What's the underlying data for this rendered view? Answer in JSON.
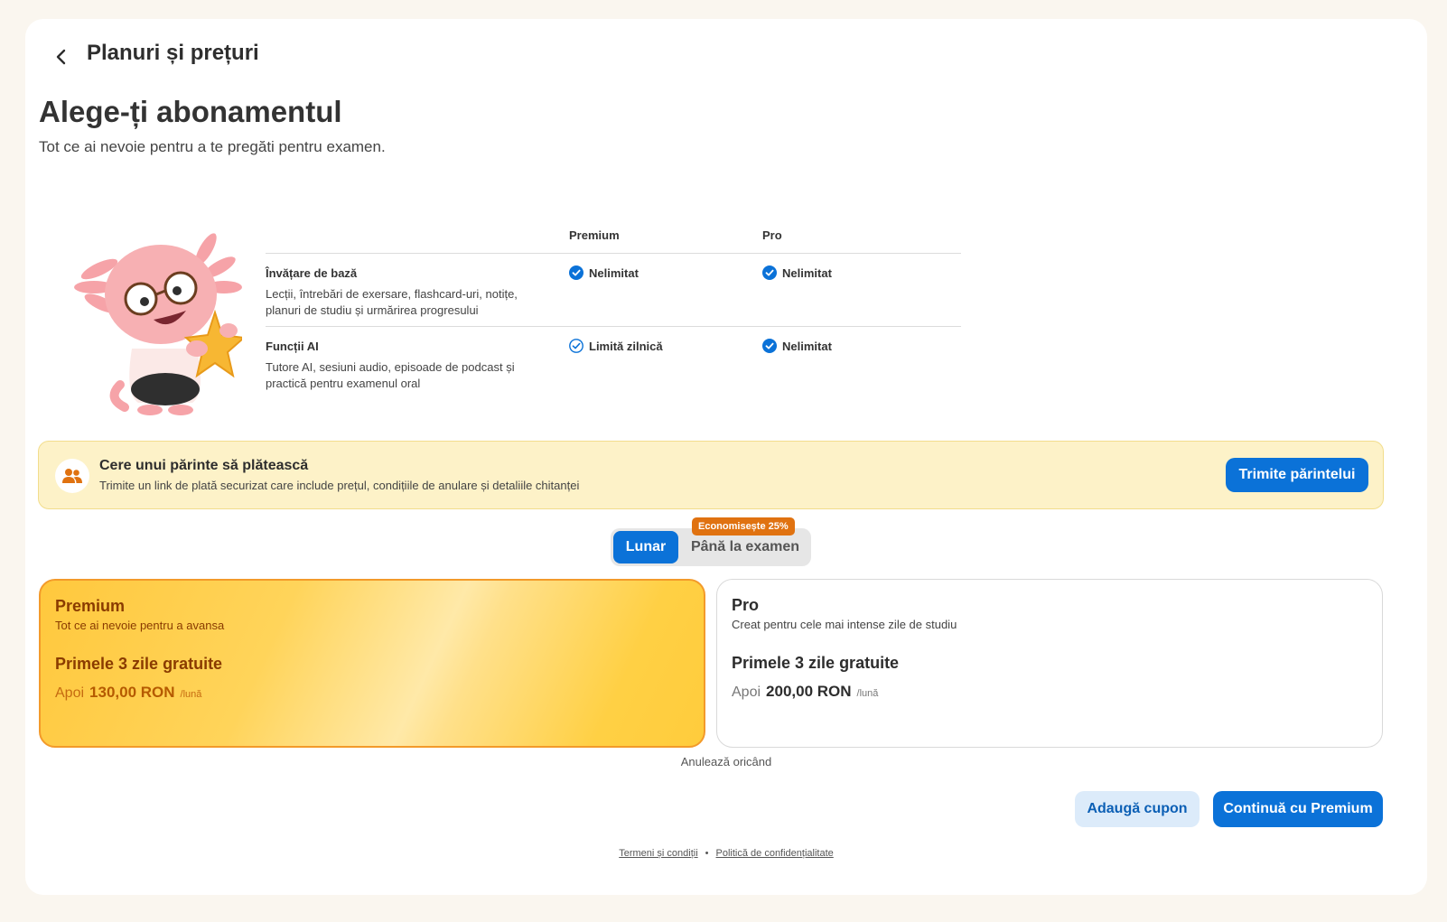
{
  "header": {
    "title": "Planuri și prețuri"
  },
  "hero": {
    "title": "Alege-ți abonamentul",
    "subtitle": "Tot ce ai nevoie pentru a te pregăti pentru examen."
  },
  "comparison": {
    "columns": [
      "Premium",
      "Pro"
    ],
    "rows": [
      {
        "name": "Învățare de bază",
        "description": "Lecții, întrebări de exersare, flashcard-uri, notițe, planuri de studiu și urmărirea progresului",
        "premium": "Nelimitat",
        "pro": "Nelimitat"
      },
      {
        "name": "Funcții AI",
        "description": "Tutore AI, sesiuni audio, episoade de podcast și practică pentru examenul oral",
        "premium": "Limită zilnică",
        "pro": "Nelimitat"
      }
    ]
  },
  "parent": {
    "title": "Cere unui părinte să plătească",
    "subtitle": "Trimite un link de plată securizat care include prețul, condițiile de anulare și detaliile chitanței",
    "button": "Trimite părintelui"
  },
  "billing_toggle": {
    "options": [
      "Lunar",
      "Până la examen"
    ],
    "selected": "Lunar",
    "badge": "Economisește 25%"
  },
  "plans": [
    {
      "name": "Premium",
      "description": "Tot ce ai nevoie pentru a avansa",
      "trial": "Primele 3 zile gratuite",
      "then": "Apoi",
      "price": "130,00 RON",
      "period": "/lună",
      "selected": true
    },
    {
      "name": "Pro",
      "description": "Creat pentru cele mai intense zile de studiu",
      "trial": "Primele 3 zile gratuite",
      "then": "Apoi",
      "price": "200,00 RON",
      "period": "/lună",
      "selected": false
    }
  ],
  "cancel_note": "Anulează oricând",
  "actions": {
    "coupon": "Adaugă cupon",
    "continue": "Continuă cu Premium"
  },
  "footer": {
    "terms": "Termeni și condiții",
    "separator": "•",
    "privacy": "Politică de confidențialitate"
  },
  "colors": {
    "primary": "#0b72d8",
    "badge": "#e07210",
    "parent_bg": "#fdf2c8",
    "premium_border": "#f39a2a"
  },
  "icons": {
    "back": "chevron-left-icon",
    "check_filled": "check-circle-filled-icon",
    "check_outline": "check-circle-outline-icon",
    "parents": "users-icon",
    "mascot": "axolotl-mascot"
  }
}
